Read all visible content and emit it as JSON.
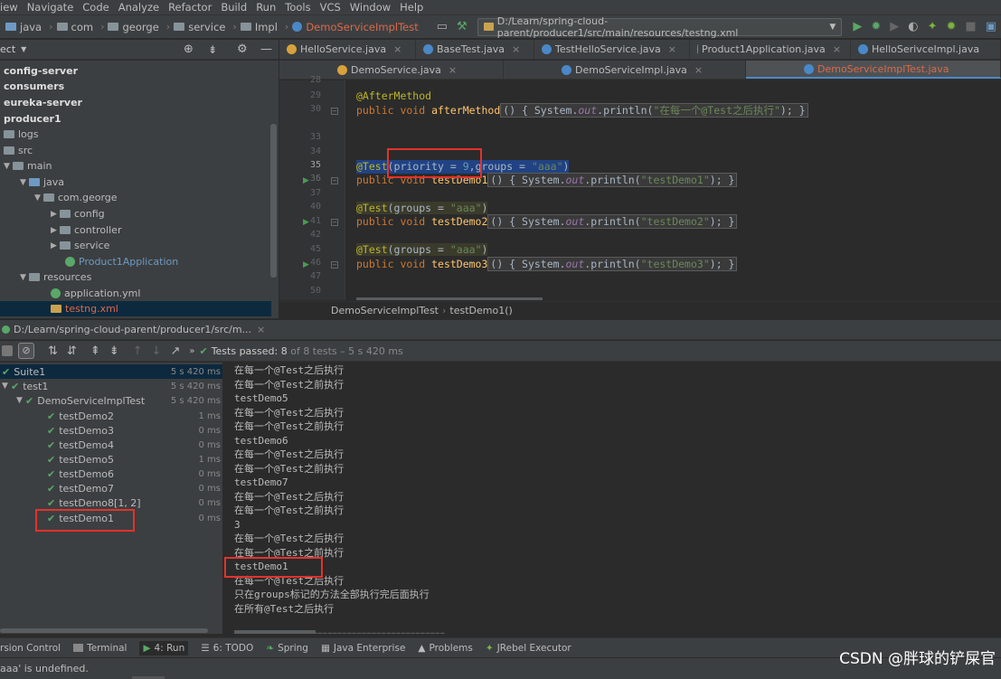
{
  "menu": [
    "iew",
    "Navigate",
    "Code",
    "Analyze",
    "Refactor",
    "Build",
    "Run",
    "Tools",
    "VCS",
    "Window",
    "Help"
  ],
  "nav": {
    "crumbs": [
      "java",
      "com",
      "george",
      "service",
      "Impl"
    ],
    "active_file": "DemoServiceImplTest",
    "run_config": "D:/Learn/spring-cloud-parent/producer1/src/main/resources/testng.xml"
  },
  "project": {
    "header": "ect",
    "tree": [
      {
        "label": "config-server",
        "bold": true
      },
      {
        "label": "consumers",
        "bold": true
      },
      {
        "label": "eureka-server",
        "bold": true
      },
      {
        "label": "producer1",
        "bold": true
      },
      {
        "label": "logs"
      },
      {
        "label": "src"
      },
      {
        "label": "main"
      },
      {
        "label": "java"
      },
      {
        "label": "com.george"
      },
      {
        "label": "config"
      },
      {
        "label": "controller"
      },
      {
        "label": "service"
      },
      {
        "label": "Product1Application"
      },
      {
        "label": "resources"
      },
      {
        "label": "application.yml"
      },
      {
        "label": "testng.xml"
      }
    ]
  },
  "editor": {
    "tabs_row1": [
      "HelloService.java",
      "BaseTest.java",
      "TestHelloService.java",
      "Product1Application.java",
      "HelloSerivceImpl.java"
    ],
    "tabs_row2": [
      "DemoService.java",
      "DemoServiceImpl.java",
      "DemoServiceImplTest.java"
    ],
    "line_numbers": [
      "28",
      "29",
      "30",
      "33",
      "34",
      "35",
      "36",
      "37",
      "40",
      "41",
      "42",
      "45",
      "46",
      "47",
      "50",
      "51"
    ],
    "code": {
      "l29": "@AfterMethod",
      "l30_kw": "public void ",
      "l30_fn": "afterMethod",
      "l30_rest": "() { System.",
      "l30_out": "out",
      "l30_print": ".println(",
      "l30_str": "\"在每一个@Test之后执行\"",
      "l30_end": "); }",
      "l36_an": "@Test",
      "l36_a": "(priority = ",
      "l36_num": "9",
      "l36_b": ",groups = ",
      "l36_str": "\"aaa\"",
      "l36_c": ")",
      "l37_fn": "testDemo1",
      "l37_str": "\"testDemo1\"",
      "l41_an": "@Test",
      "l41_a": "(groups = ",
      "l41_str": "\"aaa\"",
      "l41_c": ")",
      "l42_fn": "testDemo2",
      "l42_str": "\"testDemo2\"",
      "l46_an": "@Test",
      "l46_a": "(groups = ",
      "l46_str": "\"aaa\"",
      "l46_c": ")",
      "l47_fn": "testDemo3",
      "l47_str": "\"testDemo3\"",
      "paren_open": "() { System.",
      "dot_print": ".println(",
      "end": "); }",
      "pubvoid": "public void ",
      "out": "out"
    },
    "breadcrumb": [
      "DemoServiceImplTest",
      "testDemo1()"
    ]
  },
  "run": {
    "title": "D:/Learn/spring-cloud-parent/producer1/src/m...",
    "status_prefix": "Tests passed: ",
    "status_count": "8",
    "status_suffix": " of 8 tests – 5 s 420 ms",
    "tree": [
      {
        "label": "Suite1",
        "dur": "5 s 420 ms"
      },
      {
        "label": "test1",
        "dur": "5 s 420 ms"
      },
      {
        "label": "DemoServiceImplTest",
        "dur": "5 s 420 ms"
      },
      {
        "label": "testDemo2",
        "dur": "1 ms"
      },
      {
        "label": "testDemo3",
        "dur": "0 ms"
      },
      {
        "label": "testDemo4",
        "dur": "0 ms"
      },
      {
        "label": "testDemo5",
        "dur": "1 ms"
      },
      {
        "label": "testDemo6",
        "dur": "0 ms"
      },
      {
        "label": "testDemo7",
        "dur": "0 ms"
      },
      {
        "label": "testDemo8[1, 2]",
        "dur": "0 ms"
      },
      {
        "label": "testDemo1",
        "dur": "0 ms"
      }
    ],
    "console": [
      "在每一个@Test之后执行",
      "在每一个@Test之前执行",
      "testDemo5",
      "在每一个@Test之后执行",
      "在每一个@Test之前执行",
      "testDemo6",
      "在每一个@Test之后执行",
      "在每一个@Test之前执行",
      "testDemo7",
      "在每一个@Test之后执行",
      "在每一个@Test之前执行",
      "3",
      "在每一个@Test之后执行",
      "在每一个@Test之前执行",
      "testDemo1",
      "在每一个@Test之后执行",
      "只在groups标记的方法全部执行完后面执行",
      "在所有@Test之后执行",
      "",
      "==========================================="
    ]
  },
  "bottom_tools": [
    {
      "label": "rsion Control",
      "icon": "version-control-icon"
    },
    {
      "label": "Terminal",
      "icon": "terminal-icon"
    },
    {
      "label": "4: Run",
      "icon": "run-icon"
    },
    {
      "label": "6: TODO",
      "icon": "todo-icon"
    },
    {
      "label": "Spring",
      "icon": "spring-icon"
    },
    {
      "label": "Java Enterprise",
      "icon": "java-enterprise-icon"
    },
    {
      "label": "Problems",
      "icon": "problems-icon"
    },
    {
      "label": "JRebel Executor",
      "icon": "jrebel-icon"
    }
  ],
  "status_message": "aaa' is undefined.",
  "watermark": "CSDN @胖球的铲屎官",
  "colors": {
    "accent": "#4a88c7",
    "success": "#59a869",
    "highlight": "#e3322b"
  }
}
